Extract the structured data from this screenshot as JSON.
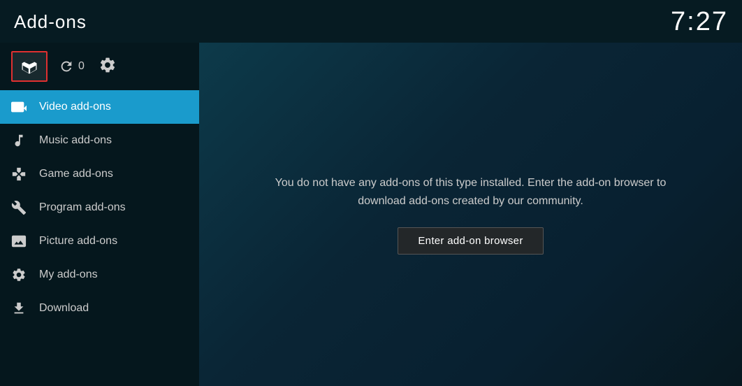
{
  "header": {
    "title": "Add-ons",
    "time": "7:27"
  },
  "toolbar": {
    "refresh_count": "0"
  },
  "nav": {
    "items": [
      {
        "id": "video",
        "label": "Video add-ons",
        "active": true,
        "icon": "video-icon"
      },
      {
        "id": "music",
        "label": "Music add-ons",
        "active": false,
        "icon": "music-icon"
      },
      {
        "id": "game",
        "label": "Game add-ons",
        "active": false,
        "icon": "game-icon"
      },
      {
        "id": "program",
        "label": "Program add-ons",
        "active": false,
        "icon": "program-icon"
      },
      {
        "id": "picture",
        "label": "Picture add-ons",
        "active": false,
        "icon": "picture-icon"
      },
      {
        "id": "myaddon",
        "label": "My add-ons",
        "active": false,
        "icon": "myaddon-icon"
      },
      {
        "id": "download",
        "label": "Download",
        "active": false,
        "icon": "download-icon"
      }
    ]
  },
  "content": {
    "empty_message": "You do not have any add-ons of this type installed. Enter the add-on browser to download add-ons created by our community.",
    "browser_button_label": "Enter add-on browser"
  }
}
